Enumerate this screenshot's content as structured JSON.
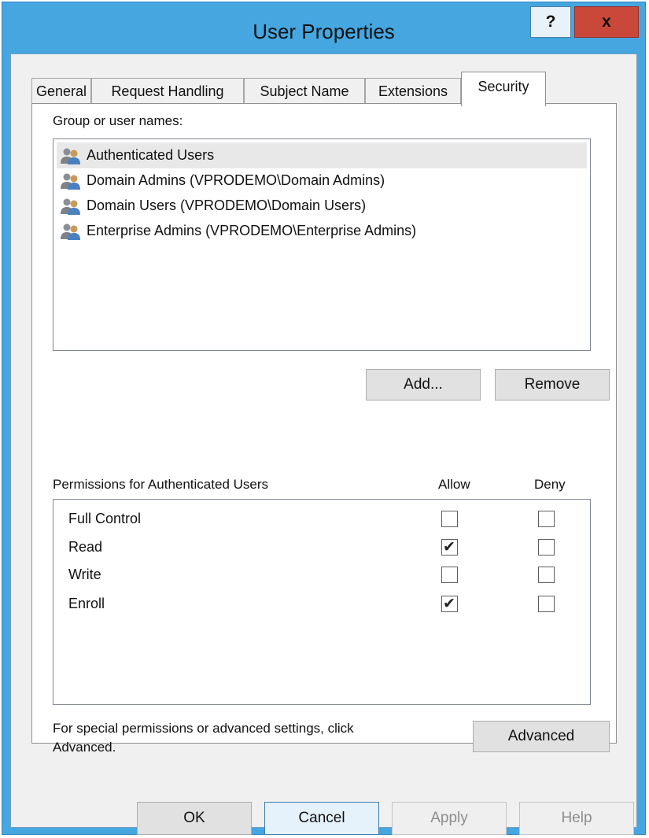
{
  "window": {
    "title": "User Properties",
    "help_label": "?",
    "close_label": "x"
  },
  "tabs": [
    {
      "label": "General",
      "active": false
    },
    {
      "label": "Request Handling",
      "active": false
    },
    {
      "label": "Subject Name",
      "active": false
    },
    {
      "label": "Extensions",
      "active": false
    },
    {
      "label": "Security",
      "active": true
    }
  ],
  "security": {
    "group_label": "Group or user names:",
    "users": [
      {
        "name": "Authenticated Users",
        "selected": true
      },
      {
        "name": "Domain Admins (VPRODEMO\\Domain Admins)",
        "selected": false
      },
      {
        "name": "Domain Users (VPRODEMO\\Domain Users)",
        "selected": false
      },
      {
        "name": "Enterprise Admins (VPRODEMO\\Enterprise Admins)",
        "selected": false
      }
    ],
    "add_label": "Add...",
    "remove_label": "Remove",
    "permissions_label": "Permissions for Authenticated Users",
    "allow_header": "Allow",
    "deny_header": "Deny",
    "permissions": [
      {
        "name": "Full Control",
        "allow": false,
        "deny": false
      },
      {
        "name": "Read",
        "allow": true,
        "deny": false
      },
      {
        "name": "Write",
        "allow": false,
        "deny": false
      },
      {
        "name": "Enroll",
        "allow": true,
        "deny": false
      }
    ],
    "advanced_text_1": "For special permissions or advanced settings, click",
    "advanced_text_2": "Advanced.",
    "advanced_label": "Advanced"
  },
  "footer": {
    "ok_label": "OK",
    "cancel_label": "Cancel",
    "apply_label": "Apply",
    "help_label": "Help"
  },
  "colors": {
    "titlebar": "#45a6e0",
    "close": "#c9483a"
  }
}
